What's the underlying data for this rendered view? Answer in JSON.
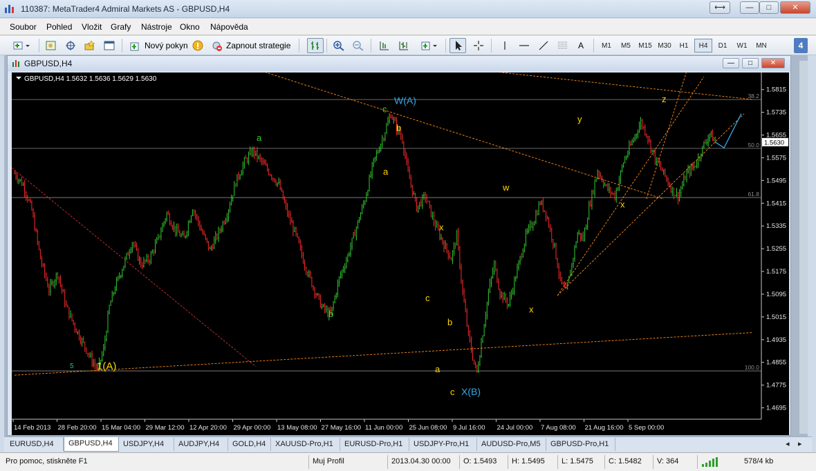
{
  "window": {
    "title": "110387: MetaTrader4 Admiral Markets AS - GBPUSD,H4",
    "restore_glyph": "⟷",
    "min_glyph": "—",
    "max_glyph": "□",
    "close_glyph": "✕"
  },
  "menu": [
    "Soubor",
    "Pohled",
    "Vložit",
    "Grafy",
    "Nástroje",
    "Okno",
    "Nápověda"
  ],
  "toolbar": {
    "new_order": "Nový pokyn",
    "auto_trading": "Zapnout strategie",
    "text_tool": "A",
    "timeframes": [
      "M1",
      "M5",
      "M15",
      "M30",
      "H1",
      "H4",
      "D1",
      "W1",
      "MN"
    ],
    "active_timeframe": "H4",
    "badge": "4"
  },
  "chart_window": {
    "title": "GBPUSD,H4",
    "info": "GBPUSD,H4  1.5632 1.5636 1.5629 1.5630",
    "current_price": "1.5630",
    "price_ticks": [
      "1.5815",
      "1.5735",
      "1.5655",
      "1.5575",
      "1.5495",
      "1.5415",
      "1.5335",
      "1.5255",
      "1.5175",
      "1.5095",
      "1.5015",
      "1.4935",
      "1.4855",
      "1.4775",
      "1.4695"
    ],
    "date_ticks": [
      "14 Feb 2013",
      "28 Feb 20:00",
      "15 Mar 04:00",
      "29 Mar 12:00",
      "12 Apr 20:00",
      "29 Apr 00:00",
      "13 May 08:00",
      "27 May 16:00",
      "11 Jun 00:00",
      "25 Jun 08:00",
      "9 Jul 16:00",
      "24 Jul 00:00",
      "7 Aug 08:00",
      "21 Aug 16:00",
      "5 Sep 00:00"
    ],
    "fib_levels": [
      {
        "label": "38.2",
        "price": 1.578
      },
      {
        "label": "50.0",
        "price": 1.5608
      },
      {
        "label": "61.8",
        "price": 1.5435
      },
      {
        "label": "100.0",
        "price": 1.4825
      }
    ],
    "wave_labels": [
      {
        "text": "5",
        "color": "#2fb8a8"
      },
      {
        "text": "1(A)",
        "color": "#ffd700"
      },
      {
        "text": "a",
        "color": "#2fd32f"
      },
      {
        "text": "b",
        "color": "#2fd32f"
      },
      {
        "text": "c",
        "color": "#2fd32f"
      },
      {
        "text": "W(A)",
        "color": "#35a8e8"
      },
      {
        "text": "b",
        "color": "#ffd700"
      },
      {
        "text": "a",
        "color": "#ffd700"
      },
      {
        "text": "x",
        "color": "#ffd700"
      },
      {
        "text": "c",
        "color": "#ffd700"
      },
      {
        "text": "b",
        "color": "#ffd700"
      },
      {
        "text": "a",
        "color": "#ffd700"
      },
      {
        "text": "c",
        "color": "#ffd700"
      },
      {
        "text": "X(B)",
        "color": "#35a8e8"
      },
      {
        "text": "w",
        "color": "#ffd700"
      },
      {
        "text": "x",
        "color": "#ffd700"
      },
      {
        "text": "y",
        "color": "#ffd700"
      },
      {
        "text": "x",
        "color": "#ffd700"
      },
      {
        "text": "z",
        "color": "#ffd700"
      }
    ],
    "colors": {
      "bull": "#32cd32",
      "bear": "#ff2a2a",
      "grid_line": "#8c8c8c",
      "trend": "#ff8c1a",
      "projection": "#35a8e8"
    }
  },
  "tabs": [
    "EURUSD,H4",
    "GBPUSD,H4",
    "USDJPY,H4",
    "AUDJPY,H4",
    "GOLD,H4",
    "XAUUSD-Pro,H1",
    "EURUSD-Pro,H1",
    "USDJPY-Pro,H1",
    "AUDUSD-Pro,M5",
    "GBPUSD-Pro,H1"
  ],
  "active_tab": "GBPUSD,H4",
  "status": {
    "help": "Pro pomoc, stiskněte F1",
    "profile": "Muj Profil",
    "datetime": "2013.04.30 00:00",
    "open": "O: 1.5493",
    "high": "H: 1.5495",
    "low": "L: 1.5475",
    "close": "C: 1.5482",
    "volume": "V: 364",
    "traffic": "578/4 kb"
  },
  "chart_data": {
    "type": "candlestick",
    "symbol": "GBPUSD",
    "timeframe": "H4",
    "ylim": [
      1.4655,
      1.5875
    ],
    "x_ticks": [
      "14 Feb 2013",
      "28 Feb 20:00",
      "15 Mar 04:00",
      "29 Mar 12:00",
      "12 Apr 20:00",
      "29 Apr 00:00",
      "13 May 08:00",
      "27 May 16:00",
      "11 Jun 00:00",
      "25 Jun 08:00",
      "9 Jul 16:00",
      "24 Jul 00:00",
      "7 Aug 08:00",
      "21 Aug 16:00",
      "5 Sep 00:00"
    ],
    "price_path": [
      [
        0,
        1.552
      ],
      [
        6,
        1.548
      ],
      [
        12,
        1.539
      ],
      [
        18,
        1.522
      ],
      [
        24,
        1.511
      ],
      [
        30,
        1.517
      ],
      [
        36,
        1.505
      ],
      [
        42,
        1.498
      ],
      [
        48,
        1.492
      ],
      [
        54,
        1.486
      ],
      [
        58,
        1.483
      ],
      [
        62,
        1.49
      ],
      [
        66,
        1.505
      ],
      [
        70,
        1.512
      ],
      [
        76,
        1.52
      ],
      [
        82,
        1.528
      ],
      [
        88,
        1.52
      ],
      [
        94,
        1.522
      ],
      [
        100,
        1.529
      ],
      [
        106,
        1.538
      ],
      [
        112,
        1.532
      ],
      [
        118,
        1.529
      ],
      [
        124,
        1.54
      ],
      [
        130,
        1.532
      ],
      [
        136,
        1.525
      ],
      [
        142,
        1.531
      ],
      [
        148,
        1.538
      ],
      [
        154,
        1.549
      ],
      [
        160,
        1.556
      ],
      [
        166,
        1.56
      ],
      [
        172,
        1.556
      ],
      [
        178,
        1.552
      ],
      [
        184,
        1.548
      ],
      [
        190,
        1.538
      ],
      [
        196,
        1.53
      ],
      [
        202,
        1.52
      ],
      [
        208,
        1.512
      ],
      [
        214,
        1.505
      ],
      [
        220,
        1.502
      ],
      [
        226,
        1.515
      ],
      [
        232,
        1.523
      ],
      [
        238,
        1.533
      ],
      [
        244,
        1.543
      ],
      [
        250,
        1.556
      ],
      [
        256,
        1.564
      ],
      [
        262,
        1.573
      ],
      [
        266,
        1.568
      ],
      [
        270,
        1.564
      ],
      [
        274,
        1.552
      ],
      [
        280,
        1.54
      ],
      [
        286,
        1.544
      ],
      [
        292,
        1.535
      ],
      [
        298,
        1.528
      ],
      [
        304,
        1.522
      ],
      [
        308,
        1.53
      ],
      [
        312,
        1.51
      ],
      [
        316,
        1.495
      ],
      [
        320,
        1.485
      ],
      [
        322,
        1.482
      ],
      [
        326,
        1.496
      ],
      [
        330,
        1.51
      ],
      [
        334,
        1.52
      ],
      [
        338,
        1.51
      ],
      [
        344,
        1.506
      ],
      [
        350,
        1.518
      ],
      [
        356,
        1.53
      ],
      [
        362,
        1.536
      ],
      [
        366,
        1.542
      ],
      [
        370,
        1.538
      ],
      [
        376,
        1.526
      ],
      [
        380,
        1.514
      ],
      [
        384,
        1.51
      ],
      [
        388,
        1.52
      ],
      [
        392,
        1.531
      ],
      [
        396,
        1.529
      ],
      [
        400,
        1.54
      ],
      [
        406,
        1.553
      ],
      [
        412,
        1.547
      ],
      [
        418,
        1.544
      ],
      [
        424,
        1.556
      ],
      [
        430,
        1.563
      ],
      [
        436,
        1.57
      ],
      [
        440,
        1.566
      ],
      [
        446,
        1.557
      ],
      [
        452,
        1.552
      ],
      [
        458,
        1.546
      ],
      [
        462,
        1.544
      ],
      [
        468,
        1.552
      ],
      [
        474,
        1.555
      ],
      [
        480,
        1.562
      ],
      [
        484,
        1.566
      ],
      [
        488,
        1.563
      ]
    ],
    "projection": [
      [
        488,
        1.563
      ],
      [
        494,
        1.561
      ],
      [
        506,
        1.573
      ]
    ],
    "fib_levels": {
      "38.2": 1.578,
      "50.0": 1.5608,
      "61.8": 1.5435,
      "100.0": 1.4825
    },
    "trendlines": [
      {
        "from": [
          0,
          1.481
        ],
        "to": [
          488,
          1.496
        ]
      },
      {
        "from": [
          160,
          1.586
        ],
        "to": [
          406,
          1.545
        ]
      },
      {
        "from": [
          406,
          1.552
        ],
        "to": [
          400,
          1.545
        ]
      },
      {
        "from": [
          338,
          1.509
        ],
        "to": [
          430,
          1.582
        ]
      },
      {
        "from": [
          338,
          1.509
        ],
        "to": [
          430,
          1.582
        ]
      }
    ]
  }
}
